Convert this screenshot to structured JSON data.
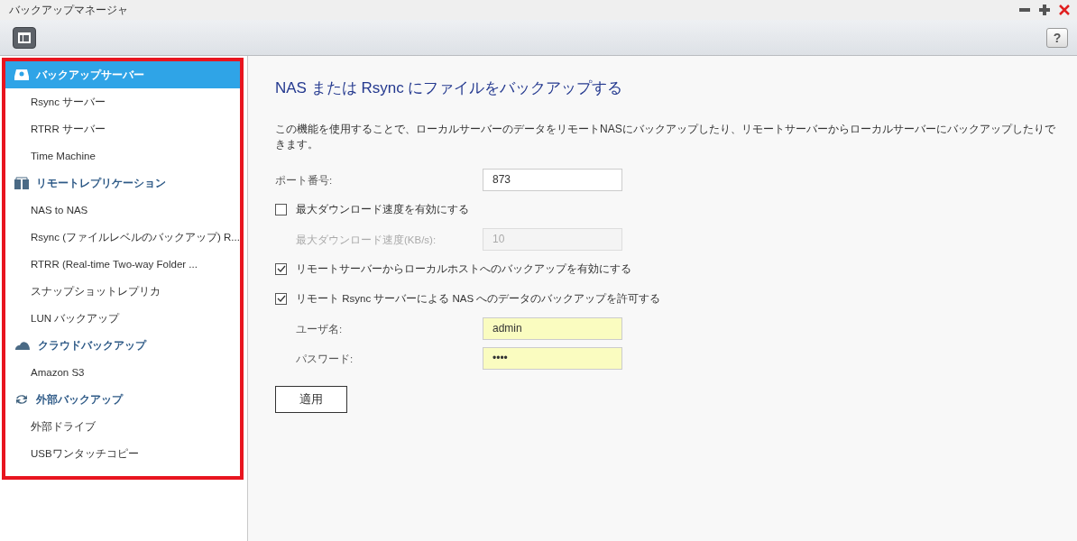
{
  "window": {
    "title": "バックアップマネージャ"
  },
  "toolbar": {
    "help_button": "?"
  },
  "sidebar": {
    "groups": [
      {
        "label": "バックアップサーバー",
        "selected": true,
        "items": [
          {
            "label": "Rsync サーバー",
            "selected": false
          },
          {
            "label": "RTRR サーバー",
            "selected": false
          },
          {
            "label": "Time Machine",
            "selected": false
          }
        ]
      },
      {
        "label": "リモートレプリケーション",
        "selected": false,
        "items": [
          {
            "label": "NAS to NAS",
            "selected": false
          },
          {
            "label": "Rsync (ファイルレベルのバックアップ) R...",
            "selected": false
          },
          {
            "label": "RTRR (Real-time Two-way Folder ...",
            "selected": false
          },
          {
            "label": "スナップショットレプリカ",
            "selected": false
          },
          {
            "label": "LUN バックアップ",
            "selected": false
          }
        ]
      },
      {
        "label": "クラウドバックアップ",
        "selected": false,
        "items": [
          {
            "label": "Amazon S3",
            "selected": false
          }
        ]
      },
      {
        "label": "外部バックアップ",
        "selected": false,
        "items": [
          {
            "label": "外部ドライブ",
            "selected": false
          },
          {
            "label": "USBワンタッチコピー",
            "selected": false
          }
        ]
      }
    ]
  },
  "content": {
    "title": "NAS または Rsync にファイルをバックアップする",
    "description": "この機能を使用することで、ローカルサーバーのデータをリモートNASにバックアップしたり、リモートサーバーからローカルサーバーにバックアップしたりできます。",
    "rows": [
      {
        "kind": "field",
        "label": "ポート番号:",
        "value": "873",
        "disabled": false,
        "autofilled": false
      },
      {
        "kind": "checkbox",
        "label": "最大ダウンロード速度を有効にする",
        "checked": false,
        "children": [
          {
            "kind": "field",
            "label": "最大ダウンロード速度(KB/s):",
            "value": "10",
            "disabled": true
          }
        ]
      },
      {
        "kind": "checkbox",
        "label": "リモートサーバーからローカルホストへのバックアップを有効にする",
        "checked": true
      },
      {
        "kind": "checkbox",
        "label": "リモート Rsync サーバーによる NAS へのデータのバックアップを許可する",
        "checked": true,
        "children": [
          {
            "kind": "field",
            "label": "ユーザ名:",
            "value": "admin",
            "disabled": false,
            "autofilled": true
          },
          {
            "kind": "field",
            "label": "パスワード:",
            "value": "••••",
            "disabled": false,
            "autofilled": true
          }
        ]
      }
    ],
    "apply_button": "適用"
  }
}
